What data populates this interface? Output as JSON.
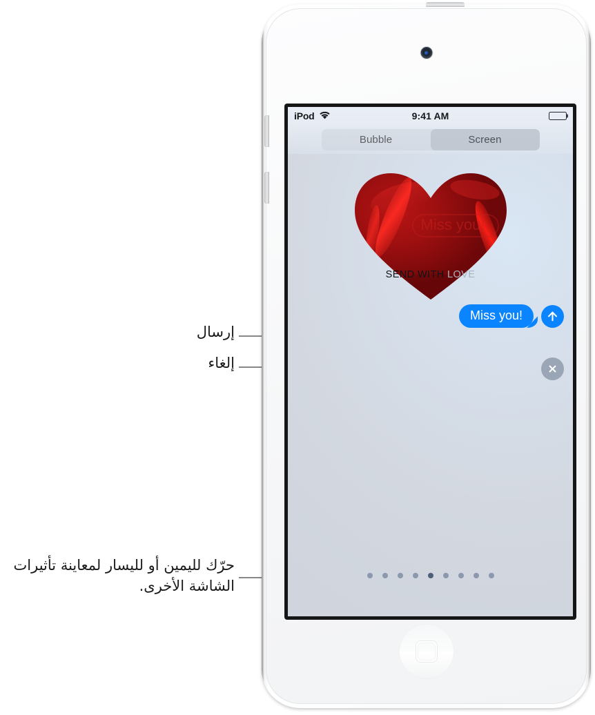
{
  "device": {
    "name": "iPod touch",
    "camera_icon": "front-camera",
    "home_button_icon": "home-square-icon"
  },
  "status_bar": {
    "carrier": "iPod",
    "wifi_icon": "wifi-icon",
    "time": "9:41 AM",
    "battery_icon": "battery-full-icon"
  },
  "segmented_control": {
    "options": [
      {
        "label": "Bubble",
        "selected": false
      },
      {
        "label": "Screen",
        "selected": true
      }
    ]
  },
  "effect": {
    "name": "heart-effect",
    "overlay_text_bold": "SEND WITH ",
    "overlay_text_light": "LOVE",
    "heart_color": "#a81414",
    "heart_highlight": "#e8171a"
  },
  "message": {
    "bubble_text": "Miss you!",
    "bubble_color": "#0b84ff",
    "send_icon": "arrow-up-icon",
    "cancel_icon": "close-x-icon",
    "cancel_color": "#9aa6b6"
  },
  "page_dots": {
    "count": 9,
    "active_index": 4,
    "dot_color": "#8b98ad",
    "active_color": "#4e6079"
  },
  "callouts": {
    "send": "إرسال",
    "cancel": "إلغاء",
    "swipe": "حرّك لليمين أو لليسار لمعاينة تأثيرات الشاشة الأخرى.",
    "line_color": "#878787"
  }
}
